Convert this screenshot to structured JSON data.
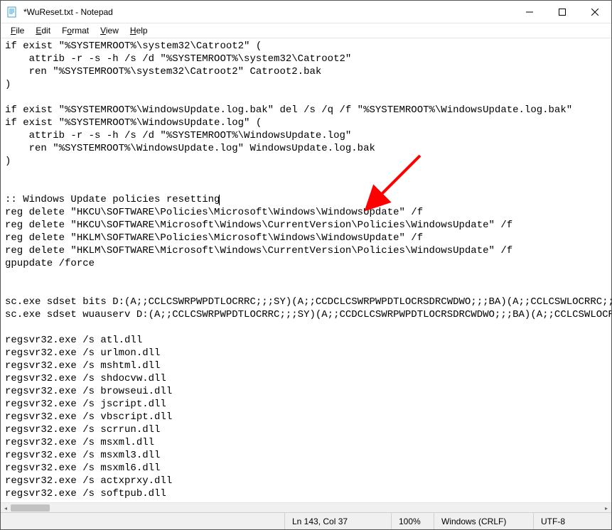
{
  "window": {
    "title": "*WuReset.txt - Notepad"
  },
  "menu": {
    "file": "File",
    "edit": "Edit",
    "format": "Format",
    "view": "View",
    "help": "Help"
  },
  "editor": {
    "lines": [
      "if exist \"%SYSTEMROOT%\\system32\\Catroot2\" (",
      "    attrib -r -s -h /s /d \"%SYSTEMROOT%\\system32\\Catroot2\"",
      "    ren \"%SYSTEMROOT%\\system32\\Catroot2\" Catroot2.bak",
      ")",
      "",
      "if exist \"%SYSTEMROOT%\\WindowsUpdate.log.bak\" del /s /q /f \"%SYSTEMROOT%\\WindowsUpdate.log.bak\"",
      "if exist \"%SYSTEMROOT%\\WindowsUpdate.log\" (",
      "    attrib -r -s -h /s /d \"%SYSTEMROOT%\\WindowsUpdate.log\"",
      "    ren \"%SYSTEMROOT%\\WindowsUpdate.log\" WindowsUpdate.log.bak",
      ")",
      "",
      "",
      ":: Windows Update policies resetting",
      "reg delete \"HKCU\\SOFTWARE\\Policies\\Microsoft\\Windows\\WindowsUpdate\" /f",
      "reg delete \"HKCU\\SOFTWARE\\Microsoft\\Windows\\CurrentVersion\\Policies\\WindowsUpdate\" /f",
      "reg delete \"HKLM\\SOFTWARE\\Policies\\Microsoft\\Windows\\WindowsUpdate\" /f",
      "reg delete \"HKLM\\SOFTWARE\\Microsoft\\Windows\\CurrentVersion\\Policies\\WindowsUpdate\" /f",
      "gpupdate /force",
      "",
      "",
      "sc.exe sdset bits D:(A;;CCLCSWRPWPDTLOCRRC;;;SY)(A;;CCDCLCSWRPWPDTLOCRSDRCWDWO;;;BA)(A;;CCLCSWLOCRRC;;;AU",
      "sc.exe sdset wuauserv D:(A;;CCLCSWRPWPDTLOCRRC;;;SY)(A;;CCDCLCSWRPWPDTLOCRSDRCWDWO;;;BA)(A;;CCLCSWLOCRRC",
      "",
      "regsvr32.exe /s atl.dll",
      "regsvr32.exe /s urlmon.dll",
      "regsvr32.exe /s mshtml.dll",
      "regsvr32.exe /s shdocvw.dll",
      "regsvr32.exe /s browseui.dll",
      "regsvr32.exe /s jscript.dll",
      "regsvr32.exe /s vbscript.dll",
      "regsvr32.exe /s scrrun.dll",
      "regsvr32.exe /s msxml.dll",
      "regsvr32.exe /s msxml3.dll",
      "regsvr32.exe /s msxml6.dll",
      "regsvr32.exe /s actxprxy.dll",
      "regsvr32.exe /s softpub.dll"
    ],
    "caret_line_index": 12,
    "caret_col": 37
  },
  "status": {
    "position": "Ln 143, Col 37",
    "zoom": "100%",
    "line_ending": "Windows (CRLF)",
    "encoding": "UTF-8"
  },
  "annotation": {
    "color": "#ff0000"
  }
}
